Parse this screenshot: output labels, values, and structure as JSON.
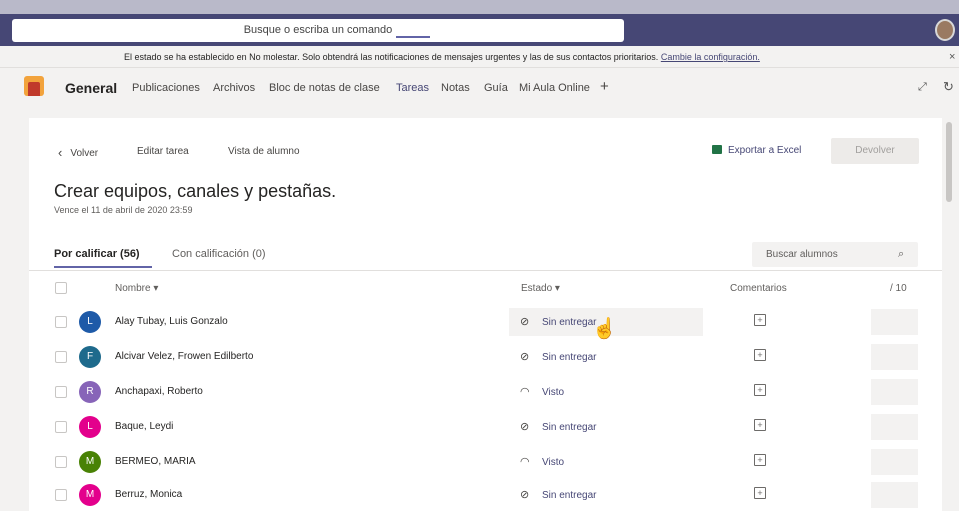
{
  "search": {
    "placeholder": "Busque o escriba un comando"
  },
  "notice": {
    "text": "El estado se ha establecido en No molestar. Solo obtendrá las notificaciones de mensajes urgentes y las de sus contactos prioritarios.",
    "link": "Cambie la configuración.",
    "close": "×"
  },
  "channel": {
    "title": "General",
    "tabs": [
      "Publicaciones",
      "Archivos",
      "Bloc de notas de clase",
      "Tareas",
      "Notas",
      "Guía",
      "Mi Aula Online",
      "+"
    ],
    "active_tab": "Tareas"
  },
  "toolbar": {
    "back": "Volver",
    "edit": "Editar tarea",
    "student_view": "Vista de alumno",
    "export": "Exportar a Excel",
    "return": "Devolver"
  },
  "assignment": {
    "title": "Crear equipos, canales y pestañas.",
    "due": "Vence el 11 de abril de 2020 23:59"
  },
  "subtabs": {
    "to_grade": "Por calificar (56)",
    "graded": "Con calificación (0)"
  },
  "student_search": {
    "placeholder": "Buscar alumnos"
  },
  "table": {
    "headers": {
      "name": "Nombre",
      "state": "Estado",
      "comments": "Comentarios",
      "points": "/ 10"
    },
    "rows": [
      {
        "initial": "L",
        "name": "Alay Tubay, Luis Gonzalo",
        "state": "Sin entregar",
        "state_icon": "not-submitted-icon",
        "avatar_color": "#1e5aa8"
      },
      {
        "initial": "F",
        "name": "Alcivar Velez, Frowen Edilberto",
        "state": "Sin entregar",
        "state_icon": "not-submitted-icon",
        "avatar_color": "#1e6a8c"
      },
      {
        "initial": "R",
        "name": "Anchapaxi, Roberto",
        "state": "Visto",
        "state_icon": "viewed-icon",
        "avatar_color": "#8764b8"
      },
      {
        "initial": "L",
        "name": "Baque, Leydi",
        "state": "Sin entregar",
        "state_icon": "not-submitted-icon",
        "avatar_color": "#e3008c"
      },
      {
        "initial": "M",
        "name": "BERMEO, MARIA",
        "state": "Visto",
        "state_icon": "viewed-icon",
        "avatar_color": "#498205"
      },
      {
        "initial": "M",
        "name": "Berruz, Monica",
        "state": "Sin entregar",
        "state_icon": "not-submitted-icon",
        "avatar_color": "#e3008c"
      }
    ]
  }
}
